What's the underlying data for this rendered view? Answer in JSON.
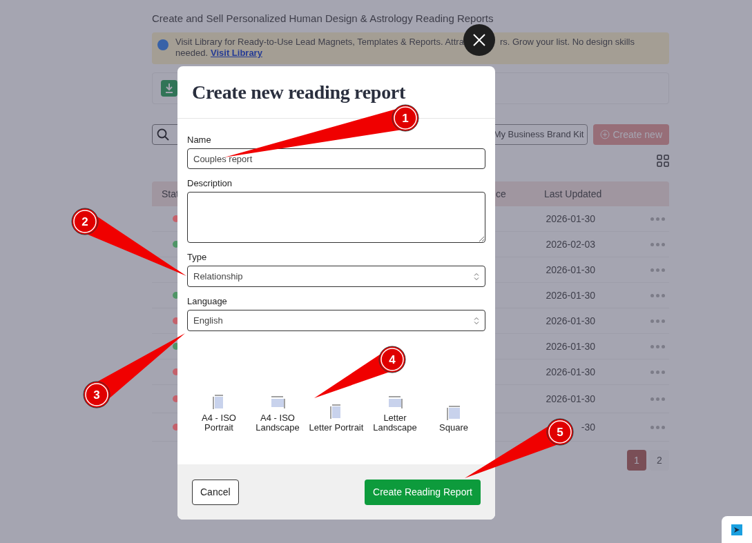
{
  "background_page": {
    "subtitle": "Create and Sell Personalized Human Design & Astrology Reading Reports",
    "banner": {
      "segments": [
        "Visit Library for Ready-to-Use Lead Magnets, Templates & Reports. Attra",
        "rs. Grow your list. No design skills",
        "needed."
      ],
      "link": "Visit Library"
    },
    "brand_kit_button": "My Business Brand Kit",
    "create_button": "Create new",
    "table": {
      "columns": [
        "Stat",
        "ce",
        "Last Updated"
      ],
      "rows": [
        {
          "color": "#c4616b",
          "last_updated": "2026-01-30"
        },
        {
          "color": "#4f9566",
          "last_updated": "2026-02-03"
        },
        {
          "last_updated": "2026-01-30"
        },
        {
          "color": "#4f9566",
          "last_updated": "2026-01-30"
        },
        {
          "color": "#c4616b",
          "last_updated": "2026-01-30"
        },
        {
          "color": "#4f9566",
          "last_updated": "2026-01-30"
        },
        {
          "color": "#c4616b",
          "last_updated": "2026-01-30"
        },
        {
          "color": "#c4616b",
          "last_updated": "2026-01-30"
        },
        {
          "color": "#c4616b",
          "last_updated": "-30"
        }
      ]
    },
    "pagination": [
      {
        "label": "1",
        "selected": true
      },
      {
        "label": "2",
        "selected": false
      }
    ]
  },
  "modal": {
    "title": "Create new reading report",
    "fields": [
      {
        "kind": "input",
        "label": "Name",
        "value": "Couples report"
      },
      {
        "kind": "textarea",
        "label": "Description"
      },
      {
        "kind": "select",
        "label": "Type",
        "value": "Relationship"
      },
      {
        "kind": "select",
        "label": "Language",
        "value": "English"
      }
    ],
    "page_sizes": [
      {
        "label": "A4 - ISO Portrait",
        "kind": "portrait"
      },
      {
        "label": "A4 - ISO Landscape",
        "kind": "landscape"
      },
      {
        "label": "Letter Portrait",
        "kind": "portrait"
      },
      {
        "label": "Letter Landscape",
        "kind": "landscape"
      },
      {
        "label": "Square",
        "kind": "square"
      }
    ],
    "cancel_button": "Cancel",
    "submit_button": "Create Reading Report"
  },
  "callouts": [
    "1",
    "2",
    "3",
    "4",
    "5"
  ]
}
